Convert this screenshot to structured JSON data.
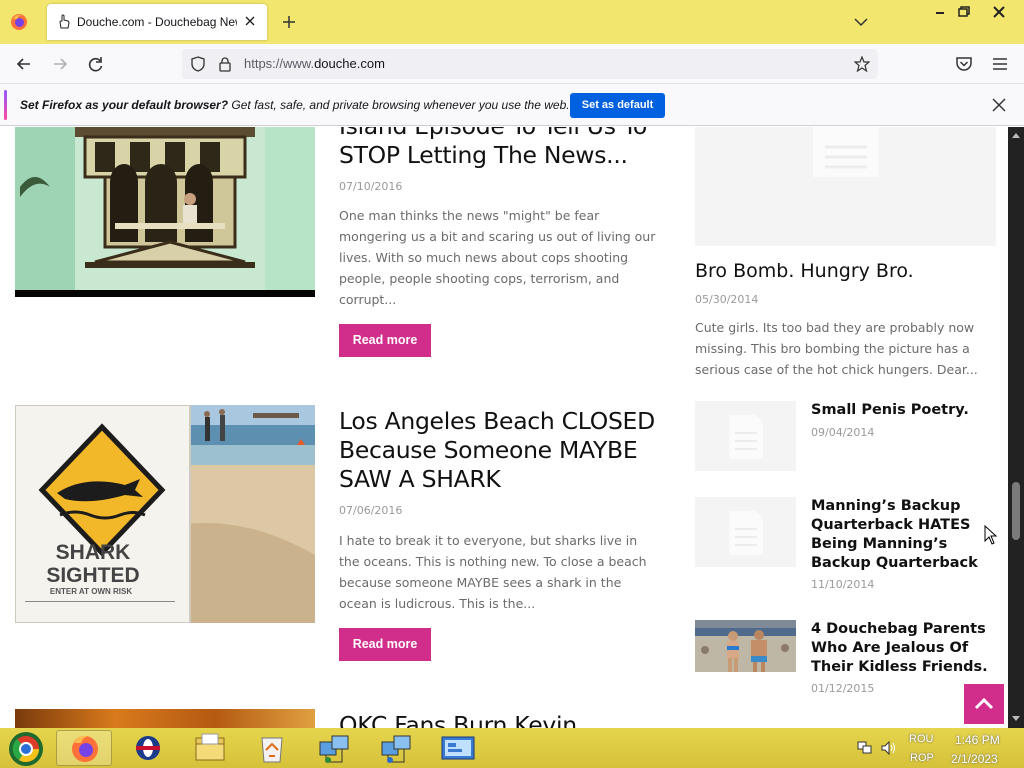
{
  "browser": {
    "tab_title": "Douche.com - Douchebag News, U",
    "url_prefix": "https://www.",
    "url_domain": "douche.com",
    "notification": {
      "bold": "Set Firefox as your default browser?",
      "text": " Get fast, safe, and private browsing whenever you use the web.",
      "button": "Set as default"
    }
  },
  "posts": [
    {
      "title": "Island Episode To Tell Us To STOP Letting The News...",
      "date": "07/10/2016",
      "excerpt": "One man thinks the news \"might\" be fear mongering us a bit and scaring us out of living our lives. With so much news about cops shooting people, people shooting cops, terrorism, and corrupt...",
      "button": "Read more"
    },
    {
      "title": "Los Angeles Beach CLOSED Because Someone MAYBE SAW A SHARK",
      "date": "07/06/2016",
      "excerpt": "I hate to break it to everyone, but sharks live in the oceans. This is nothing new. To close a beach because someone MAYBE sees a shark in the ocean is ludicrous. This is the...",
      "button": "Read more",
      "sign_line1": "SHARK",
      "sign_line2": "SIGHTED",
      "sign_line3": "ENTER AT OWN RISK"
    },
    {
      "title": "OKC Fans Burn Kevin"
    }
  ],
  "sidebar": {
    "featured": {
      "title": "Bro Bomb. Hungry Bro.",
      "date": "05/30/2014",
      "excerpt": "  Cute girls. Its too bad they are probably now missing. This bro bombing the picture has a serious case of the hot chick hungers. Dear..."
    },
    "items": [
      {
        "title": "Small Penis Poetry.",
        "date": "09/04/2014"
      },
      {
        "title": "Manning’s Backup Quarterback HATES Being Manning’s Backup Quarterback",
        "date": "11/10/2014"
      },
      {
        "title": "4 Douchebag Parents Who Are Jealous Of Their Kidless Friends.",
        "date": "01/12/2015"
      }
    ]
  },
  "taskbar": {
    "lang_top": "ROU",
    "lang_bottom": "ROP",
    "time": "1:46 PM",
    "date": "2/1/2023"
  },
  "colors": {
    "accent": "#d12d8b",
    "tabbar": "#f2e66e",
    "firefox_blue": "#0061e0"
  }
}
